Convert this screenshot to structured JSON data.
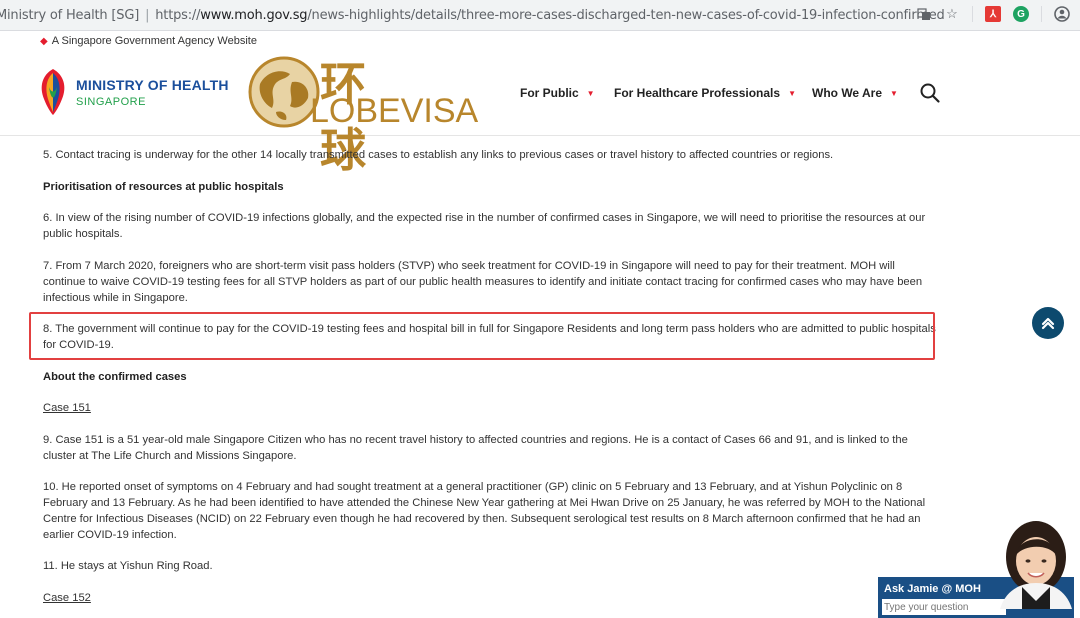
{
  "browser": {
    "tab_title": "Ministry of Health [SG]",
    "url_scheme": "https://",
    "url_host": "www.moh.gov.sg",
    "url_path": "/news-highlights/details/three-more-cases-discharged-ten-new-cases-of-covid-19-infection-confirmed",
    "icons": [
      "translate-icon",
      "star-icon",
      "pdf-extension-icon",
      "grammarly-icon",
      "account-icon"
    ]
  },
  "gov_banner": {
    "text": "A Singapore Government Agency Website"
  },
  "header": {
    "logo_title": "MINISTRY OF HEALTH",
    "logo_subtitle": "SINGAPORE",
    "watermark_zh": "环 球",
    "watermark_en": "LOBEVISA",
    "nav": [
      {
        "label": "For Public"
      },
      {
        "label": "For Healthcare Professionals"
      },
      {
        "label": "Who We Are"
      }
    ]
  },
  "article": {
    "p5": "5. Contact tracing is underway for the other 14 locally transmitted cases to establish any links to previous cases or travel history to affected countries or regions.",
    "h_prioritisation": "Prioritisation of resources at public hospitals",
    "p6": "6. In view of the rising number of COVID-19 infections globally, and the expected rise in the number of confirmed cases in Singapore, we will need to prioritise the resources at our public hospitals.",
    "p7": "7. From 7 March 2020, foreigners who are short-term visit pass holders (STVP) who seek treatment for COVID-19 in Singapore will need to pay for their treatment. MOH will continue to waive COVID-19 testing fees for all STVP holders as part of our public health measures to identify and initiate contact tracing for confirmed cases who may have been infectious while in Singapore.",
    "p8": "8. The government will continue to pay for the COVID-19 testing fees and hospital bill in full for Singapore Residents and long term pass holders who are admitted to public hospitals for COVID-19.",
    "h_about": "About the confirmed cases",
    "case151": "Case 151",
    "p9": "9. Case 151 is a 51 year-old male Singapore Citizen who has no recent travel history to affected countries and regions. He is a contact of Cases 66 and 91, and is linked to the cluster at The Life Church and Missions Singapore.",
    "p10": "10. He reported onset of symptoms on 4 February and had sought treatment at a general practitioner (GP) clinic on 5 February and 13 February, and at Yishun Polyclinic on 8 February and 13 February. As he had been identified to have attended the Chinese New Year gathering at Mei Hwan Drive on 25 January, he was referred by MOH to the National Centre for Infectious Diseases (NCID) on 22 February even though he had recovered by then. Subsequent serological test results on 8 March afternoon confirmed that he had an earlier COVID-19 infection.",
    "p11": "11. He stays at Yishun Ring Road.",
    "case152": "Case 152"
  },
  "chat": {
    "title": "Ask Jamie @ MOH",
    "placeholder": "Type your question"
  },
  "colors": {
    "moh_blue": "#1b4f9c",
    "moh_green": "#22a04b",
    "accent_red": "#e41d2e",
    "highlight_border": "#e24040",
    "back_to_top": "#0d4a6e",
    "watermark_gold": "#b8862c"
  }
}
